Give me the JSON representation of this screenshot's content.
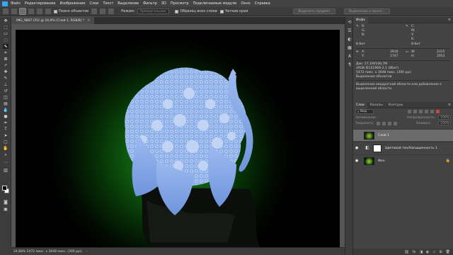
{
  "menu": {
    "items": [
      "Файл",
      "Редактирование",
      "Изображение",
      "Слои",
      "Текст",
      "Выделение",
      "Фильтр",
      "3D",
      "Просмотр",
      "Подключаемые модули",
      "Окно",
      "Справка"
    ]
  },
  "options": {
    "object_finder": "Поиск объектов",
    "mode_label": "Режим:",
    "mode_value": "Прямоугольник",
    "sample_all_layers": "Образец всех слоев",
    "hard_edge": "Четкие края",
    "select_subject": "Выделить предмет",
    "select_and_mask": "Выделение и маска..."
  },
  "document": {
    "tab_title": "IMG_9807.CR2 @ 24,9% (Слой 1, RGB/8) *",
    "close_glyph": "×"
  },
  "status": {
    "text": "24,88%    5472 пикс. x 3648 пикс. (300 ppi)",
    "arrow": "›"
  },
  "info_panel": {
    "tab": "Инфо",
    "r": "R:",
    "g": "G:",
    "b": "B:",
    "c": "C:",
    "m": "M:",
    "y": "Y:",
    "k": "K:",
    "bits_left": "8-бит",
    "bits_right": "8-бит",
    "x": "X:",
    "y_coord": "Y:",
    "x_val": "3916",
    "y_val": "1747",
    "w": "W:",
    "h": "H:",
    "w_val": "2315",
    "h_val": "2053",
    "doc_line": "Док: 57,1M/108,7M",
    "profile_line": "sRGB IEC61966-2.1 (8бит)",
    "size_line": "5472 пикс. x 3648 пикс. (300 ppi)",
    "tool_line": "Выделение объектов",
    "hint": "Выделение квадратной области или добавление к выделенной области."
  },
  "layers_panel": {
    "tabs": [
      "Слои",
      "Каналы",
      "Контуры"
    ],
    "kind": "Вид",
    "blend_mode": "Затемнение",
    "opacity_label": "Непрозрачность:",
    "opacity_value": "100%",
    "lock_label": "Закрепить:",
    "fill_label": "Заливка:",
    "fill_value": "100%",
    "layers": [
      {
        "name": "Слой 1",
        "visible": false,
        "selected": true
      },
      {
        "name": "Цветовой тон/Насыщенность 1",
        "visible": true,
        "selected": false
      },
      {
        "name": "Фон",
        "visible": true,
        "selected": false
      }
    ],
    "eye_glyph": "●",
    "lock_glyph": "🔒"
  },
  "colors": {
    "ui_dark": "#3c3c3c",
    "ui_panel": "#434343",
    "selection_blue": "#7aa6e8",
    "backdrop_green": "#1f8a1f"
  }
}
